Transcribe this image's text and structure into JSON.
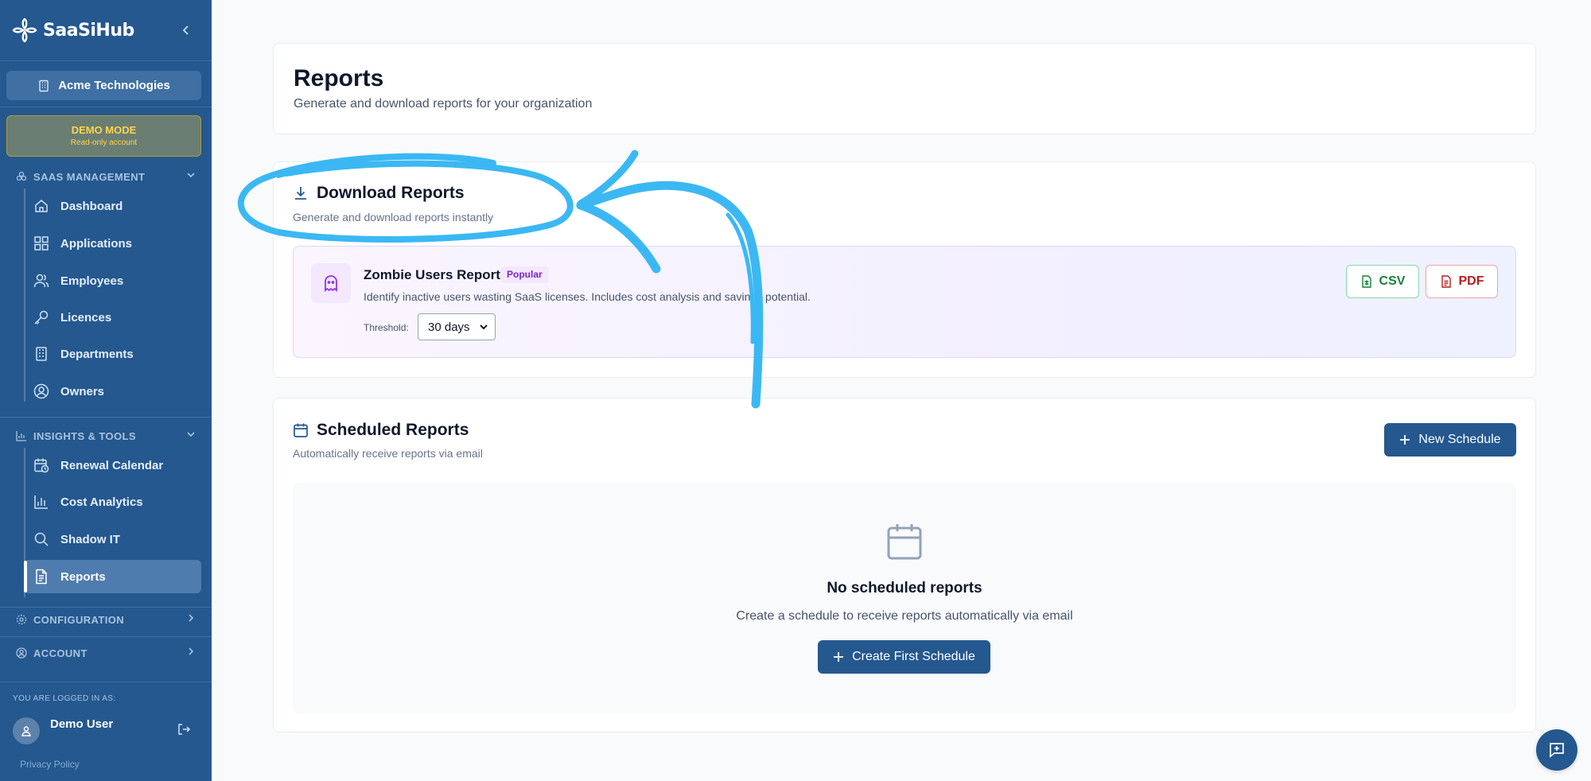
{
  "brand": {
    "name": "SaaSiHub"
  },
  "sidebar": {
    "org": "Acme Technologies",
    "demo": {
      "title": "DEMO MODE",
      "subtitle": "Read-only account"
    },
    "sections": {
      "saas": "SAAS MANAGEMENT",
      "insights": "INSIGHTS & TOOLS",
      "configuration": "CONFIGURATION",
      "account": "ACCOUNT"
    },
    "saas_items": [
      {
        "label": "Dashboard",
        "icon": "home-icon"
      },
      {
        "label": "Applications",
        "icon": "grid-icon"
      },
      {
        "label": "Employees",
        "icon": "users-icon"
      },
      {
        "label": "Licences",
        "icon": "key-icon"
      },
      {
        "label": "Departments",
        "icon": "building-icon"
      },
      {
        "label": "Owners",
        "icon": "user-circle-icon"
      }
    ],
    "insights_items": [
      {
        "label": "Renewal Calendar",
        "icon": "calendar-clock-icon"
      },
      {
        "label": "Cost Analytics",
        "icon": "bar-chart-icon"
      },
      {
        "label": "Shadow IT",
        "icon": "search-icon"
      },
      {
        "label": "Reports",
        "icon": "file-text-icon",
        "active": true
      }
    ],
    "logged_in_label": "YOU ARE LOGGED IN AS:",
    "user": "Demo User",
    "privacy": "Privacy Policy"
  },
  "header": {
    "title": "Reports",
    "subtitle": "Generate and download reports for your organization"
  },
  "download": {
    "title": "Download Reports",
    "subtitle": "Generate and download reports instantly",
    "report": {
      "title": "Zombie Users Report",
      "badge": "Popular",
      "description": "Identify inactive users wasting SaaS licenses. Includes cost analysis and savings potential.",
      "threshold_label": "Threshold:",
      "threshold_value": "30 days",
      "csv": "CSV",
      "pdf": "PDF"
    }
  },
  "scheduled": {
    "title": "Scheduled Reports",
    "subtitle": "Automatically receive reports via email",
    "new_button": "New Schedule",
    "empty_title": "No scheduled reports",
    "empty_subtitle": "Create a schedule to receive reports automatically via email",
    "create_button": "Create First Schedule"
  },
  "colors": {
    "sidebar": "#24588f",
    "primary": "#24588f",
    "annotation": "#38b6f0"
  }
}
